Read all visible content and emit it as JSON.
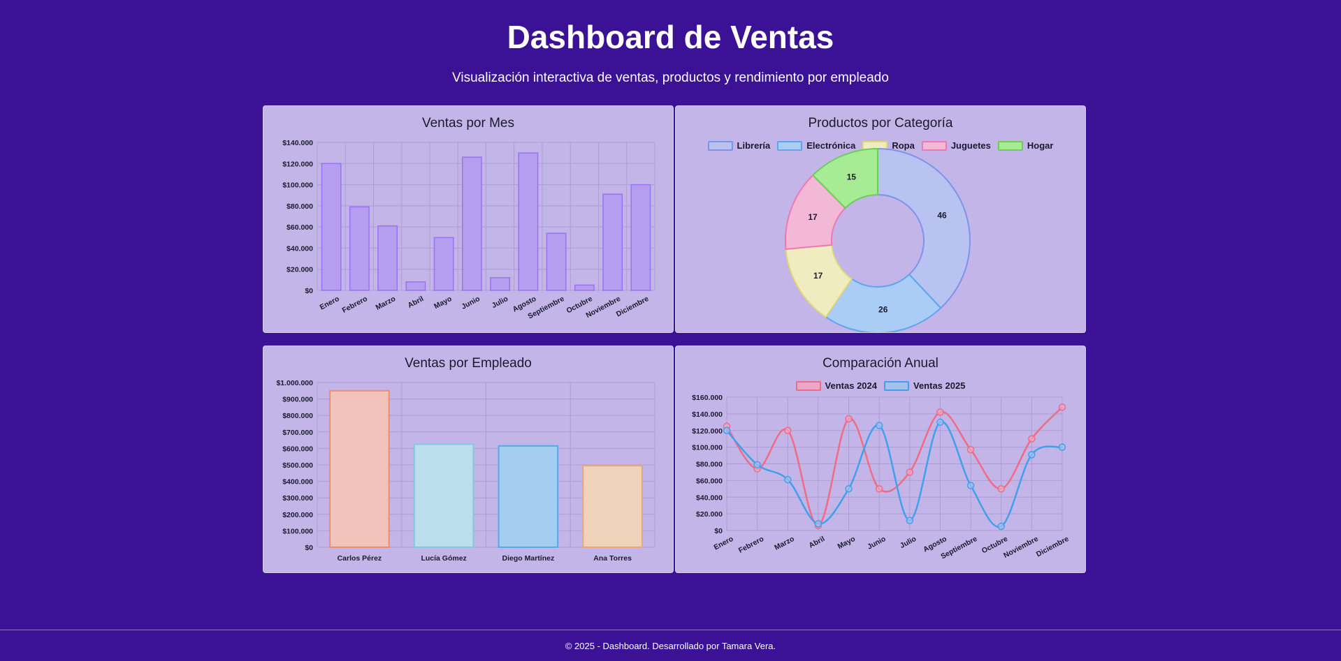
{
  "header": {
    "title": "Dashboard de Ventas",
    "subtitle": "Visualización interactiva de ventas, productos y rendimiento por empleado"
  },
  "footer": {
    "text": "© 2025 - Dashboard. Desarrollado por Tamara Vera."
  },
  "charts": {
    "monthly": {
      "title": "Ventas por Mes"
    },
    "category": {
      "title": "Productos por Categoría"
    },
    "employee": {
      "title": "Ventas por Empleado"
    },
    "annual": {
      "title": "Comparación Anual"
    }
  },
  "chart_data": [
    {
      "id": "monthly",
      "type": "bar",
      "title": "Ventas por Mes",
      "categories": [
        "Enero",
        "Febrero",
        "Marzo",
        "Abril",
        "Mayo",
        "Junio",
        "Julio",
        "Agosto",
        "Septiembre",
        "Octubre",
        "Noviembre",
        "Diciembre"
      ],
      "values": [
        120000,
        79000,
        61000,
        8000,
        50000,
        126000,
        12000,
        130000,
        54000,
        5000,
        91000,
        100000
      ],
      "ylim": [
        0,
        140000
      ],
      "ytick_step": 20000,
      "ytick_labels": [
        "$0",
        "$20.000",
        "$40.000",
        "$60.000",
        "$80.000",
        "$100.000",
        "$120.000",
        "$140.000"
      ],
      "grid": true,
      "colors": {
        "fill": "#b59ef0",
        "stroke": "#9a72f4"
      }
    },
    {
      "id": "category",
      "type": "pie",
      "title": "Productos por Categoría",
      "variant": "doughnut",
      "legend_position": "top",
      "labels": [
        "Librería",
        "Electrónica",
        "Ropa",
        "Juguetes",
        "Hogar"
      ],
      "values": [
        46,
        26,
        17,
        17,
        15
      ],
      "fill_colors": [
        "#b9c3f2",
        "#a9cdf4",
        "#efedbf",
        "#f2b8d6",
        "#a8eb95"
      ],
      "stroke_colors": [
        "#7c94ea",
        "#5fa4ef",
        "#e0d776",
        "#ef78b4",
        "#69d055"
      ]
    },
    {
      "id": "employee",
      "type": "bar",
      "title": "Ventas por Empleado",
      "categories": [
        "Carlos Pérez",
        "Lucía Gómez",
        "Diego Martínez",
        "Ana Torres"
      ],
      "values": [
        950000,
        625000,
        615000,
        495000
      ],
      "ylim": [
        0,
        1000000
      ],
      "ytick_step": 100000,
      "ytick_labels": [
        "$0",
        "$100.000",
        "$200.000",
        "$300.000",
        "$400.000",
        "$500.000",
        "$600.000",
        "$700.000",
        "$800.000",
        "$900.000",
        "$1.000.000"
      ],
      "grid": true,
      "fill_colors": [
        "#f2c3bb",
        "#bbdeec",
        "#a5cdf0",
        "#f0d1b9"
      ],
      "stroke_colors": [
        "#ec8c70",
        "#86c6e0",
        "#5aa8e8",
        "#eba77a"
      ]
    },
    {
      "id": "annual",
      "type": "line",
      "title": "Comparación Anual",
      "legend_position": "top",
      "categories": [
        "Enero",
        "Febrero",
        "Marzo",
        "Abril",
        "Mayo",
        "Junio",
        "Julio",
        "Agosto",
        "Septiembre",
        "Octubre",
        "Noviembre",
        "Diciembre"
      ],
      "series": [
        {
          "name": "Ventas 2024",
          "values": [
            125000,
            74000,
            120000,
            6000,
            134000,
            50000,
            70000,
            142000,
            97000,
            50000,
            110000,
            148000
          ],
          "color": "#f06b86",
          "fill": "#e9a8c8"
        },
        {
          "name": "Ventas 2025",
          "values": [
            120000,
            79000,
            61000,
            8000,
            50000,
            126000,
            12000,
            130000,
            54000,
            5000,
            91000,
            100000
          ],
          "color": "#41a0ec",
          "fill": "#a4bff0"
        }
      ],
      "ylim": [
        0,
        160000
      ],
      "ytick_step": 20000,
      "ytick_labels": [
        "$0",
        "$20.000",
        "$40.000",
        "$60.000",
        "$80.000",
        "$100.000",
        "$120.000",
        "$140.000",
        "$160.000"
      ],
      "grid": true,
      "smooth": true
    }
  ]
}
